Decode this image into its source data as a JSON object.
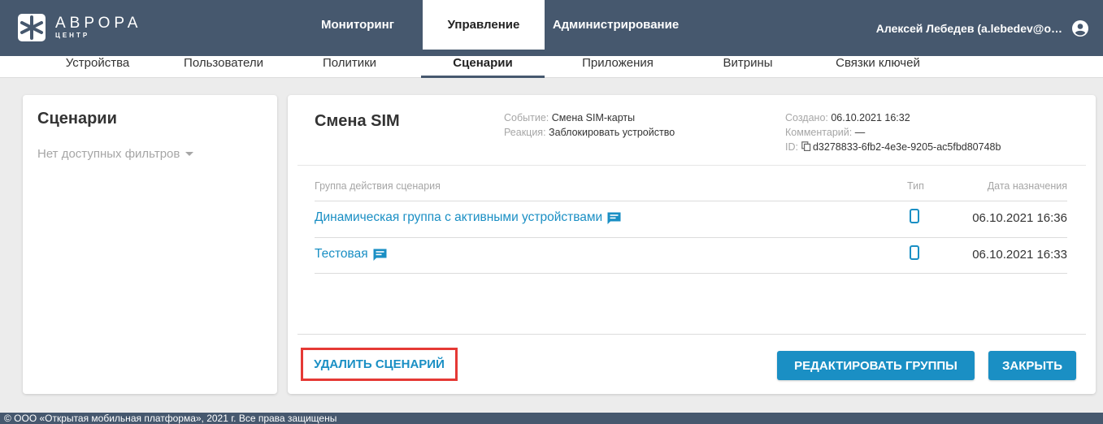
{
  "header": {
    "logo_title": "АВРОРА",
    "logo_subtitle": "ЦЕНТР",
    "tabs": [
      {
        "label": "Мониторинг"
      },
      {
        "label": "Управление"
      },
      {
        "label": "Администрирование"
      }
    ],
    "user": "Алексей Лебедев (a.lebedev@o…",
    "colors": {
      "bar": "#46586e",
      "accent": "#1a8fc4"
    }
  },
  "subnav": {
    "items": [
      {
        "label": "Устройства"
      },
      {
        "label": "Пользователи"
      },
      {
        "label": "Политики"
      },
      {
        "label": "Сценарии"
      },
      {
        "label": "Приложения"
      },
      {
        "label": "Витрины"
      },
      {
        "label": "Связки ключей"
      }
    ]
  },
  "left": {
    "title": "Сценарии",
    "filter": "Нет доступных фильтров"
  },
  "scenario": {
    "title": "Смена SIM",
    "event_label": "Событие:",
    "event_value": "Смена SIM-карты",
    "reaction_label": "Реакция:",
    "reaction_value": "Заблокировать устройство",
    "created_label": "Создано:",
    "created_value": "06.10.2021 16:32",
    "comment_label": "Комментарий:",
    "comment_value": "—",
    "id_label": "ID:",
    "id_value": "d3278833-6fb2-4e3e-9205-ac5fbd80748b"
  },
  "table": {
    "col_group": "Группа действия сценария",
    "col_type": "Тип",
    "col_date": "Дата назначения",
    "rows": [
      {
        "name": "Динамическая группа с активными устройствами",
        "type_icon": "phone-icon",
        "date": "06.10.2021 16:36"
      },
      {
        "name": "Тестовая",
        "type_icon": "phone-icon",
        "date": "06.10.2021 16:33"
      }
    ]
  },
  "actions": {
    "delete": "УДАЛИТЬ СЦЕНАРИЙ",
    "edit": "РЕДАКТИРОВАТЬ ГРУППЫ",
    "close": "ЗАКРЫТЬ"
  },
  "footer": {
    "text": "© ООО «Открытая мобильная платформа», 2021 г. Все права защищены"
  }
}
